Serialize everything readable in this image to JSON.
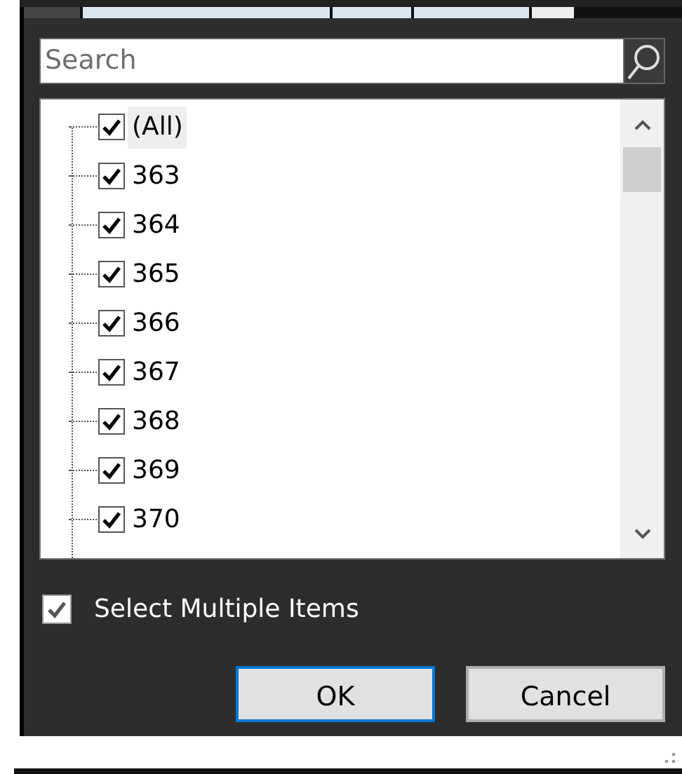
{
  "search": {
    "placeholder": "Search"
  },
  "items": [
    {
      "label": "(All)",
      "checked": true,
      "selected": true
    },
    {
      "label": "363",
      "checked": true,
      "selected": false
    },
    {
      "label": "364",
      "checked": true,
      "selected": false
    },
    {
      "label": "365",
      "checked": true,
      "selected": false
    },
    {
      "label": "366",
      "checked": true,
      "selected": false
    },
    {
      "label": "367",
      "checked": true,
      "selected": false
    },
    {
      "label": "368",
      "checked": true,
      "selected": false
    },
    {
      "label": "369",
      "checked": true,
      "selected": false
    },
    {
      "label": "370",
      "checked": true,
      "selected": false
    }
  ],
  "select_multiple": {
    "label": "Select Multiple Items",
    "checked": true
  },
  "buttons": [
    {
      "label": "OK",
      "default": true
    },
    {
      "label": "Cancel",
      "default": false
    }
  ]
}
